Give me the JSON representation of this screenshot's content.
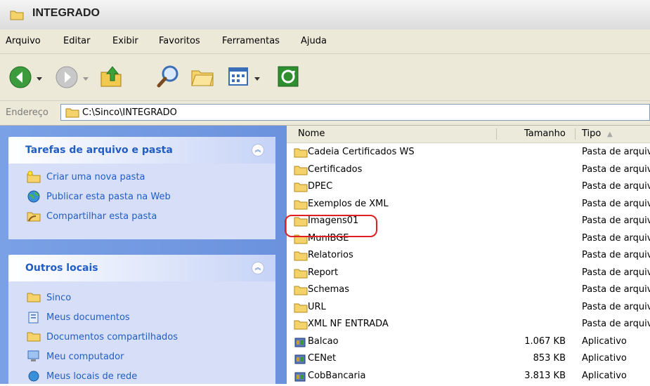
{
  "window": {
    "title": "INTEGRADO"
  },
  "menu": [
    "Arquivo",
    "Editar",
    "Exibir",
    "Favoritos",
    "Ferramentas",
    "Ajuda"
  ],
  "toolbar": {
    "buttons": [
      "back-icon",
      "forward-icon",
      "folder-up-icon",
      "search-icon",
      "folders-icon",
      "views-icon",
      "sync-icon"
    ]
  },
  "address": {
    "label": "Endereço",
    "path": "C:\\Sinco\\INTEGRADO"
  },
  "left": {
    "file_tasks": {
      "title": "Tarefas de arquivo e pasta",
      "items": [
        "Criar uma nova pasta",
        "Publicar esta pasta na Web",
        "Compartilhar esta pasta"
      ]
    },
    "other_places": {
      "title": "Outros locais",
      "items": [
        "Sinco",
        "Meus documentos",
        "Documentos compartilhados",
        "Meu computador",
        "Meus locais de rede"
      ]
    }
  },
  "columns": {
    "name": "Nome",
    "size": "Tamanho",
    "type": "Tipo"
  },
  "files": [
    {
      "name": "Cadeia Certificados WS",
      "size": "",
      "type": "Pasta de arquivos",
      "icon": "folder-icon"
    },
    {
      "name": "Certificados",
      "size": "",
      "type": "Pasta de arquivos",
      "icon": "folder-icon"
    },
    {
      "name": "DPEC",
      "size": "",
      "type": "Pasta de arquivos",
      "icon": "folder-icon"
    },
    {
      "name": "Exemplos de XML",
      "size": "",
      "type": "Pasta de arquivos",
      "icon": "folder-icon"
    },
    {
      "name": "Imagens01",
      "size": "",
      "type": "Pasta de arquivos",
      "icon": "folder-icon"
    },
    {
      "name": "MunIBGE",
      "size": "",
      "type": "Pasta de arquivos",
      "icon": "folder-icon"
    },
    {
      "name": "Relatorios",
      "size": "",
      "type": "Pasta de arquivos",
      "icon": "folder-icon"
    },
    {
      "name": "Report",
      "size": "",
      "type": "Pasta de arquivos",
      "icon": "folder-icon"
    },
    {
      "name": "Schemas",
      "size": "",
      "type": "Pasta de arquivos",
      "icon": "folder-icon"
    },
    {
      "name": "URL",
      "size": "",
      "type": "Pasta de arquivos",
      "icon": "folder-icon"
    },
    {
      "name": "XML NF ENTRADA",
      "size": "",
      "type": "Pasta de arquivos",
      "icon": "folder-icon"
    },
    {
      "name": "Balcao",
      "size": "1.067 KB",
      "type": "Aplicativo",
      "icon": "app-icon"
    },
    {
      "name": "CENet",
      "size": "853 KB",
      "type": "Aplicativo",
      "icon": "app-icon"
    },
    {
      "name": "CobBancaria",
      "size": "3.813 KB",
      "type": "Aplicativo",
      "icon": "app-icon"
    }
  ]
}
